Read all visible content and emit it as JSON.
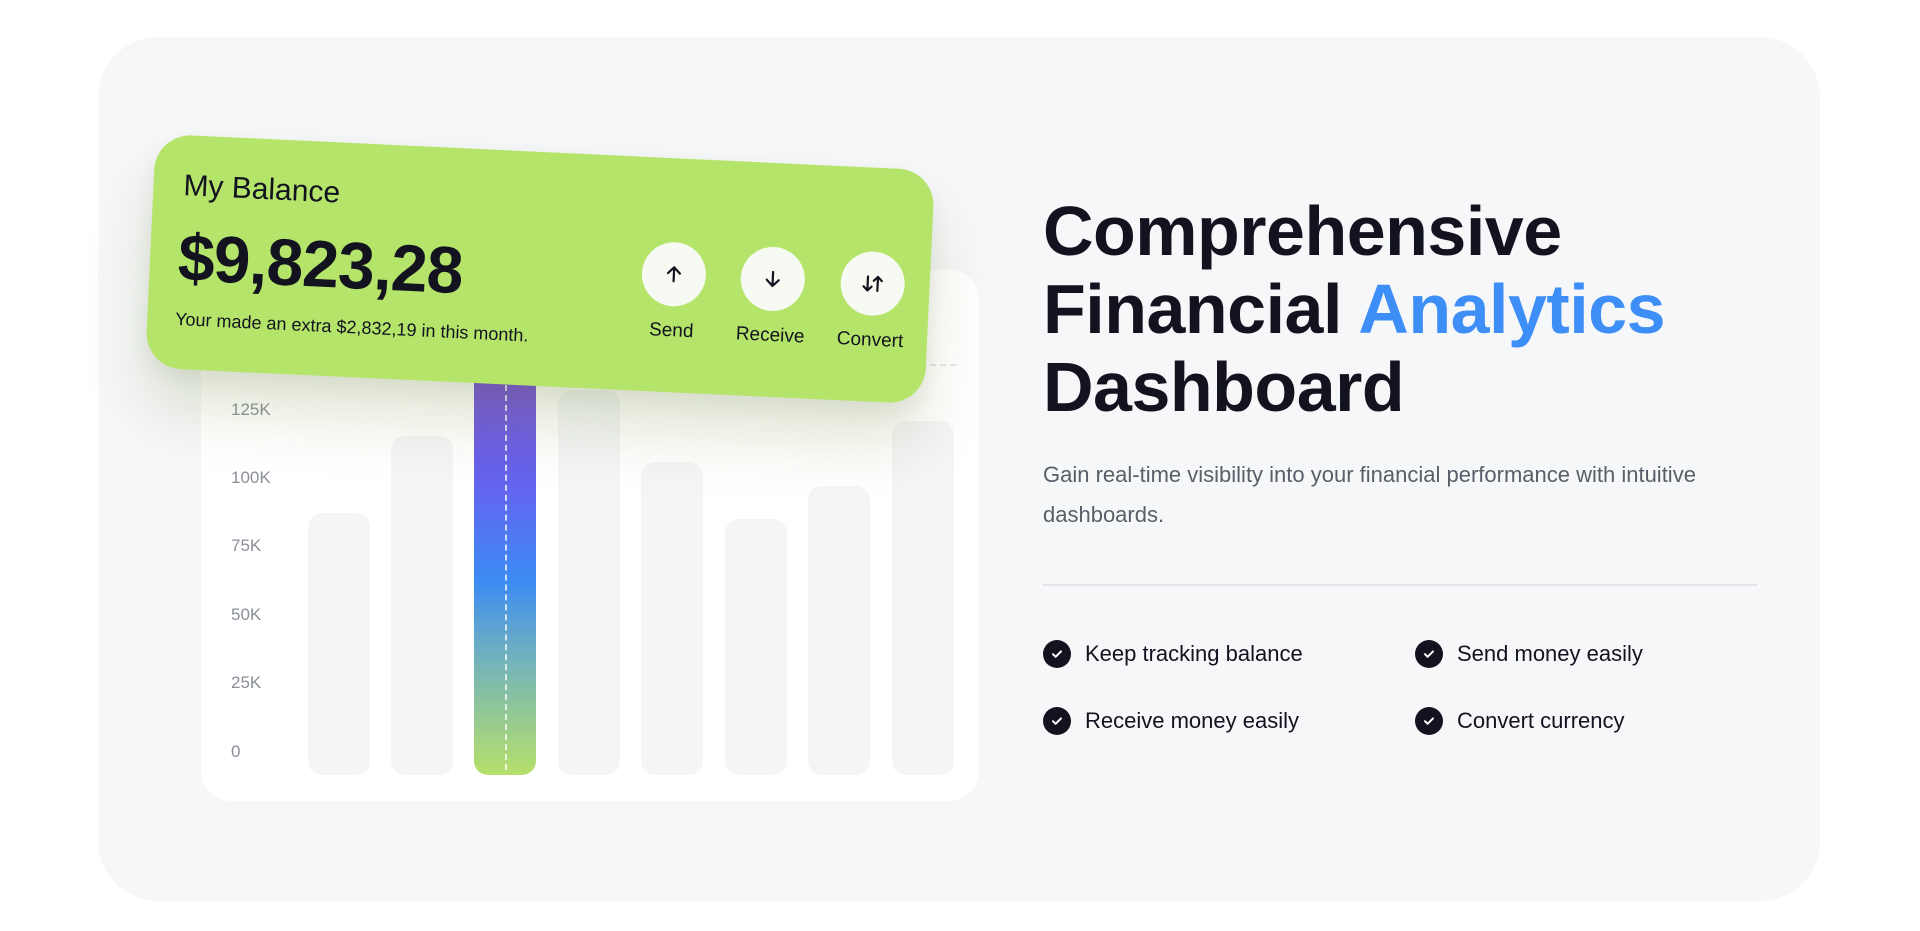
{
  "balance_card": {
    "title": "My Balance",
    "amount": "$9,823,28",
    "note": "Your made an extra $2,832,19 in this month.",
    "actions": [
      {
        "label": "Send",
        "icon": "arrow-up-icon"
      },
      {
        "label": "Receive",
        "icon": "arrow-down-icon"
      },
      {
        "label": "Convert",
        "icon": "swap-arrows-icon"
      }
    ]
  },
  "chart": {
    "y_ticks": [
      "125K",
      "100K",
      "75K",
      "50K",
      "25K",
      "0"
    ],
    "highlighted_bar_index": 2,
    "colors": {
      "bar": "#f4f5f7",
      "gradient": [
        "#7a4fd6",
        "#6266f0",
        "#3c8bf4",
        "#6fb0c0",
        "#b6e06a"
      ]
    }
  },
  "hero": {
    "heading_line1": "Comprehensive",
    "heading_line2_plain": "Financial",
    "heading_line2_accent": "Analytics",
    "heading_line3": "Dashboard",
    "subtext": "Gain real-time visibility into your financial performance with intuitive dashboards."
  },
  "features": [
    "Keep tracking balance",
    "Send money easily",
    "Receive money easily",
    "Convert currency"
  ],
  "colors": {
    "accent": "#3e8ef7",
    "card_green": "#b5e46a",
    "text_dark": "#12131f",
    "section_bg": "#f6f7f9"
  }
}
